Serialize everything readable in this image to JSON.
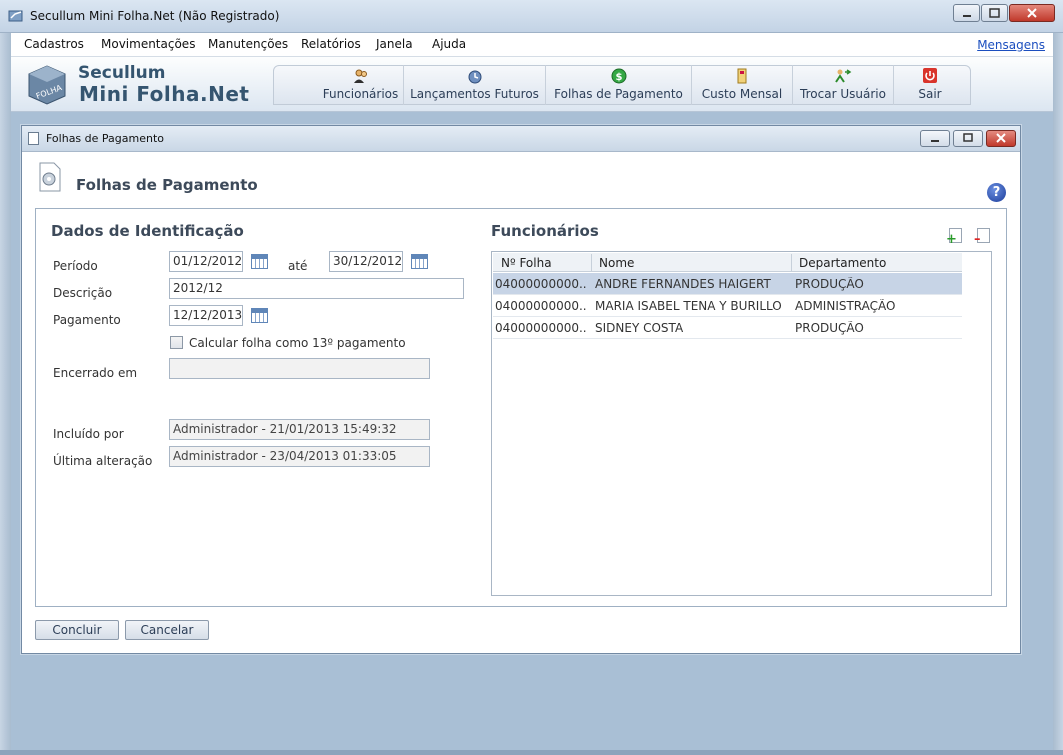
{
  "window": {
    "title": "Secullum Mini Folha.Net (Não Registrado)"
  },
  "menu": {
    "items": [
      "Cadastros",
      "Movimentações",
      "Manutenções",
      "Relatórios",
      "Janela",
      "Ajuda"
    ],
    "messages_link": "Mensagens"
  },
  "brand": {
    "line1": "Secullum",
    "line2": "Mini Folha.Net",
    "logo_text": "FOLHA"
  },
  "toolbar": {
    "buttons": [
      {
        "label": "Funcionários",
        "icon": "users-icon"
      },
      {
        "label": "Lançamentos Futuros",
        "icon": "future-entries-icon"
      },
      {
        "label": "Folhas de Pagamento",
        "icon": "money-icon"
      },
      {
        "label": "Custo Mensal",
        "icon": "monthly-cost-icon"
      },
      {
        "label": "Trocar Usuário",
        "icon": "switch-user-icon"
      },
      {
        "label": "Sair",
        "icon": "power-icon"
      }
    ]
  },
  "child_window": {
    "title": "Folhas de Pagamento"
  },
  "form": {
    "heading": "Folhas de Pagamento",
    "help": "?",
    "identification": {
      "title": "Dados de Identificação",
      "periodo_label": "Período",
      "periodo_from": "01/12/2012",
      "ate_label": "até",
      "periodo_to": "30/12/2012",
      "descricao_label": "Descrição",
      "descricao": "2012/12",
      "pagamento_label": "Pagamento",
      "pagamento": "12/12/2013",
      "checkbox_label": "Calcular folha como 13º pagamento",
      "checkbox_checked": false,
      "encerrado_label": "Encerrado em",
      "encerrado": "",
      "incluido_label": "Incluído por",
      "incluido": "Administrador - 21/01/2013 15:49:32",
      "alteracao_label": "Última alteração",
      "alteracao": "Administrador - 23/04/2013 01:33:05"
    },
    "employees": {
      "title": "Funcionários",
      "columns": [
        "Nº Folha",
        "Nome",
        "Departamento"
      ],
      "rows": [
        {
          "folha": "04000000000...",
          "nome": "ANDRE FERNANDES HAIGERT",
          "dept": "PRODUÇÃO",
          "selected": true
        },
        {
          "folha": "04000000000...",
          "nome": "MARIA ISABEL TENA Y BURILLO",
          "dept": "ADMINISTRAÇÃO",
          "selected": false
        },
        {
          "folha": "04000000000...",
          "nome": "SIDNEY COSTA",
          "dept": "PRODUÇÃO",
          "selected": false
        }
      ]
    },
    "buttons": {
      "confirm": "Concluir",
      "cancel": "Cancelar"
    }
  }
}
